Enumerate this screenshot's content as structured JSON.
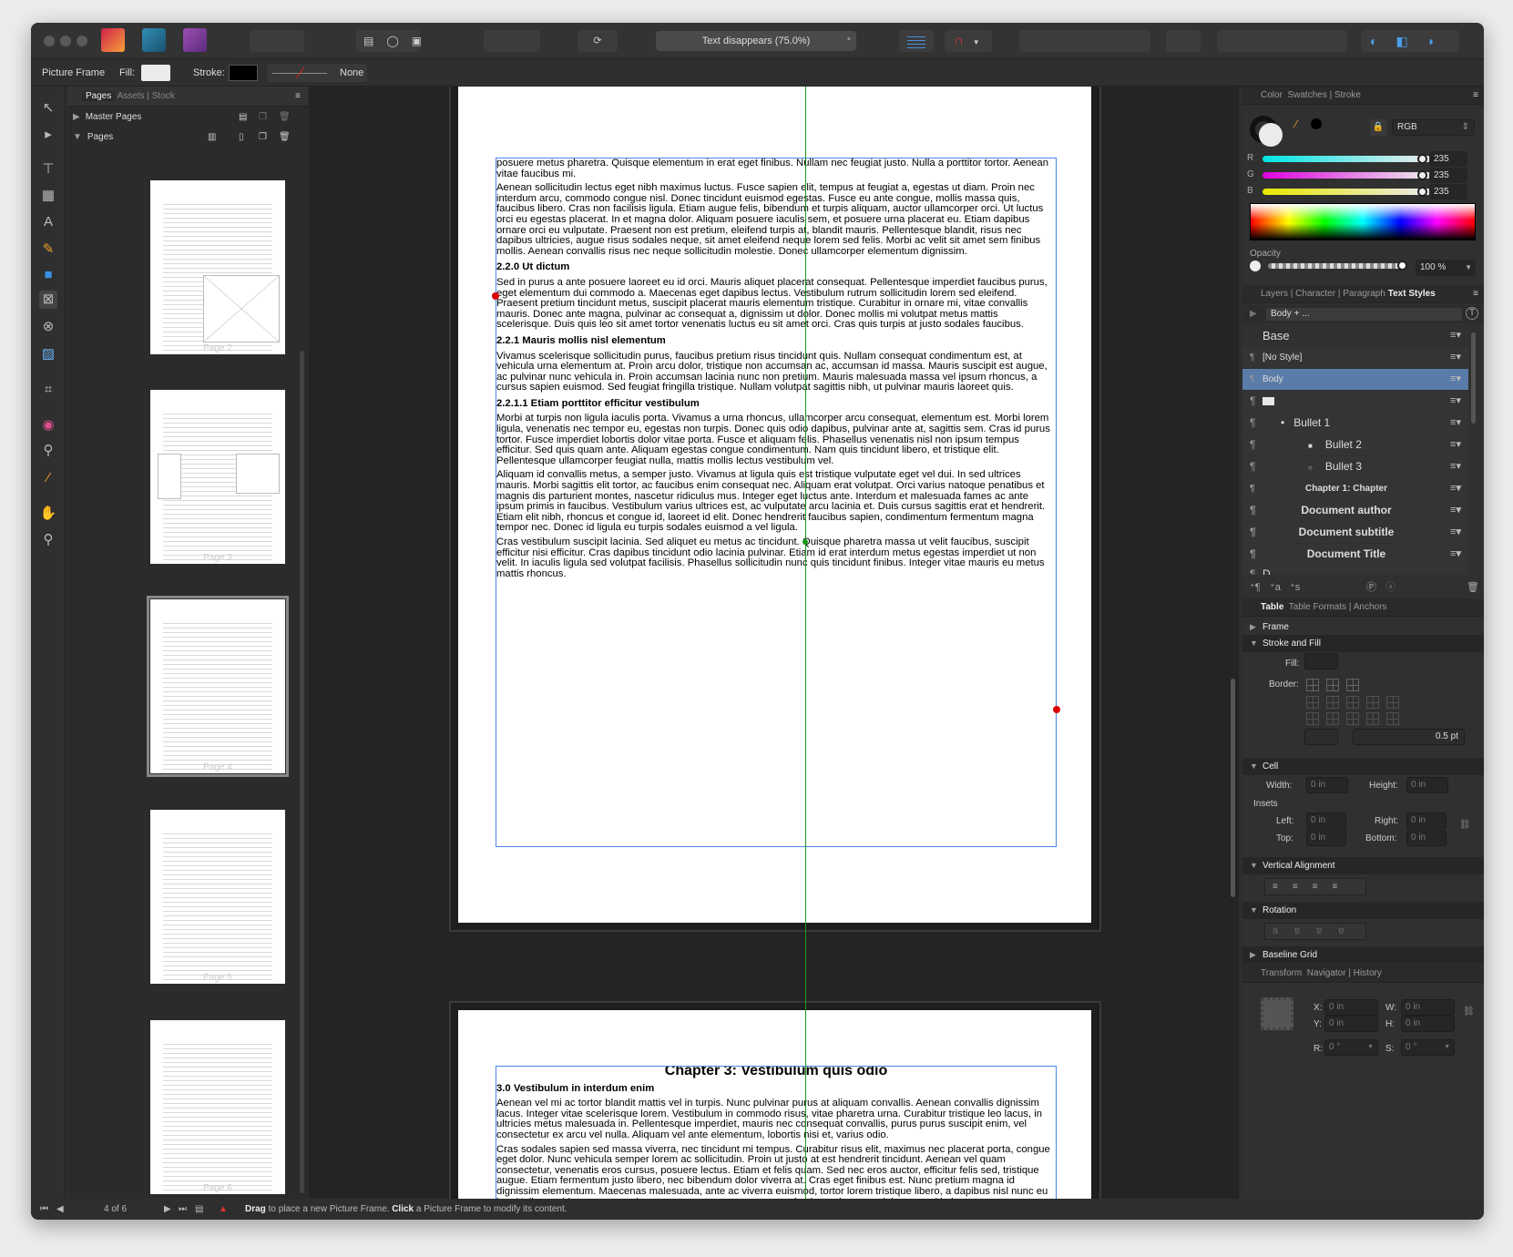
{
  "toolbar": {
    "title_field": "Text disappears (75.0%)",
    "title_star": "*"
  },
  "context": {
    "tool": "Picture Frame",
    "fill_label": "Fill:",
    "stroke_label": "Stroke:",
    "stroke_value": "None",
    "fill_color": "#ebebeb",
    "stroke_color": "#000000"
  },
  "pages_panel": {
    "tabs": [
      "Pages",
      "Assets",
      "Stock"
    ],
    "master_pages": "Master Pages",
    "pages": "Pages",
    "thumbnails": [
      {
        "label": "Page 2"
      },
      {
        "label": "Page 3"
      },
      {
        "label": "Page 4"
      },
      {
        "label": "Page 5"
      },
      {
        "label": "Page 6"
      }
    ],
    "selected": "Page 4"
  },
  "document": {
    "page1": [
      {
        "type": "p",
        "text": "posuere metus pharetra. Quisque elementum in erat eget finibus. Nullam nec feugiat justo. Nulla a porttitor tortor. Aenean vitae faucibus mi."
      },
      {
        "type": "p",
        "text": "Aenean sollicitudin lectus eget nibh maximus luctus. Fusce sapien elit, tempus at feugiat a, egestas ut diam. Proin nec interdum arcu, commodo congue nisl. Donec tincidunt euismod egestas. Fusce eu ante congue, mollis massa quis, faucibus libero. Cras non facilisis ligula. Etiam augue felis, bibendum et turpis aliquam, auctor ullamcorper orci. Ut luctus orci eu egestas placerat. In et magna dolor. Aliquam posuere iaculis sem, et posuere urna placerat eu. Etiam dapibus ornare orci eu vulputate. Praesent non est pretium, eleifend turpis at, blandit mauris. Pellentesque blandit, risus nec dapibus ultricies, augue risus sodales neque, sit amet eleifend neque lorem sed felis. Morbi ac velit sit amet sem finibus mollis. Aenean convallis risus nec neque sollicitudin molestie. Donec ullamcorper elementum dignissim."
      },
      {
        "type": "h",
        "text": "2.2.0 Ut dictum"
      },
      {
        "type": "p",
        "text": "Sed in purus a ante posuere laoreet eu id orci. Mauris aliquet placerat consequat. Pellentesque imperdiet faucibus purus, eget elementum dui commodo a. Maecenas eget dapibus lectus. Vestibulum rutrum sollicitudin lorem sed eleifend. Praesent pretium tincidunt metus, suscipit placerat mauris elementum tristique. Curabitur in ornare mi, vitae convallis mauris. Donec ante magna, pulvinar ac consequat a, dignissim ut dolor. Donec mollis mi volutpat metus mattis scelerisque. Duis quis leo sit amet tortor venenatis luctus eu sit amet orci. Cras quis turpis at justo sodales faucibus."
      },
      {
        "type": "h",
        "text": "2.2.1 Mauris mollis nisl elementum"
      },
      {
        "type": "p",
        "text": "Vivamus scelerisque sollicitudin purus, faucibus pretium risus tincidunt quis. Nullam consequat condimentum est, at vehicula urna elementum at. Proin arcu dolor, tristique non accumsan ac, accumsan id massa. Mauris suscipit est augue, ac pulvinar nunc vehicula in. Proin accumsan lacinia nunc non pretium. Mauris malesuada massa vel ipsum rhoncus, a cursus sapien euismod. Sed feugiat fringilla tristique. Nullam volutpat sagittis nibh, ut pulvinar mauris laoreet quis."
      },
      {
        "type": "h",
        "text": "2.2.1.1 Etiam porttitor efficitur vestibulum"
      },
      {
        "type": "p",
        "text": "Morbi at turpis non ligula iaculis porta. Vivamus a urna rhoncus, ullamcorper arcu consequat, elementum est. Morbi lorem ligula, venenatis nec tempor eu, egestas non turpis. Donec quis odio dapibus, pulvinar ante at, sagittis sem. Cras id purus tortor. Fusce imperdiet lobortis dolor vitae porta. Fusce et aliquam felis. Phasellus venenatis nisl non ipsum tempus efficitur. Sed quis quam ante. Aliquam egestas congue condimentum. Nam quis tincidunt libero, et tristique elit. Pellentesque ullamcorper feugiat nulla, mattis mollis lectus vestibulum vel."
      },
      {
        "type": "p",
        "text": "Aliquam id convallis metus, a semper justo. Vivamus at ligula quis est tristique vulputate eget vel dui. In sed ultrices mauris. Morbi sagittis elit tortor, ac faucibus enim consequat nec. Aliquam erat volutpat. Orci varius natoque penatibus et magnis dis parturient montes, nascetur ridiculus mus. Integer eget luctus ante. Interdum et malesuada fames ac ante ipsum primis in faucibus. Vestibulum varius ultrices est, ac vulputate arcu lacinia et. Duis cursus sagittis erat et hendrerit. Etiam elit nibh, rhoncus et congue id, laoreet id elit. Donec hendrerit faucibus sapien, condimentum fermentum magna tempor nec. Donec id ligula eu turpis sodales euismod a vel ligula."
      },
      {
        "type": "p",
        "text": "Cras vestibulum suscipit lacinia. Sed aliquet eu metus ac tincidunt. Quisque pharetra massa ut velit faucibus, suscipit efficitur nisi efficitur. Cras dapibus tincidunt odio lacinia pulvinar. Etiam id erat interdum metus egestas imperdiet ut non velit. In iaculis ligula sed volutpat facilisis. Phasellus sollicitudin nunc quis tincidunt finibus. Integer vitae mauris eu metus mattis rhoncus."
      }
    ],
    "page2": {
      "chapter_title": "Chapter 3: Vestibulum quis odio",
      "heading": "3.0 Vestibulum in interdum enim",
      "paragraphs": [
        "Aenean vel mi ac tortor blandit mattis vel in turpis. Nunc pulvinar purus at aliquam convallis. Aenean convallis dignissim lacus. Integer vitae scelerisque lorem. Vestibulum in commodo risus, vitae pharetra urna. Curabitur tristique leo lacus, in ultricies metus malesuada in. Pellentesque imperdiet, mauris nec consequat convallis, purus purus suscipit enim, vel consectetur ex arcu vel nulla. Aliquam vel ante elementum, lobortis nisi et, varius odio.",
        "Cras sodales sapien sed massa viverra, nec tincidunt mi tempus. Curabitur risus elit, maximus nec placerat porta, congue eget dolor. Nunc vehicula semper lorem ac sollicitudin. Proin ut justo at est hendrerit tincidunt. Aenean vel quam consectetur, venenatis eros cursus, posuere lectus. Etiam et felis quam. Sed nec eros auctor, efficitur felis sed, tristique augue. Etiam fermentum justo libero, nec bibendum dolor viverra at. Cras eget finibus est. Nunc pretium magna id dignissim elementum. Maecenas malesuada, ante ac viverra euismod, tortor lorem tristique libero, a dapibus nisl nunc eu leo. Nulla gravida, urna ut maximus consequat, massa massa molestie turpis, eu sagittis nunc mi in justo."
      ]
    }
  },
  "color_panel": {
    "tabs": [
      "Color",
      "Swatches",
      "Stroke"
    ],
    "model": "RGB",
    "r_label": "R",
    "g_label": "G",
    "b_label": "B",
    "r": "235",
    "g": "235",
    "b": "235",
    "opacity_label": "Opacity",
    "opacity": "100 %"
  },
  "styles_panel": {
    "tabs": [
      "Layers",
      "Character",
      "Paragraph",
      "Text Styles"
    ],
    "active_tab": "Text Styles",
    "current": "Body + ...",
    "group": "Base",
    "styles": [
      "[No Style]",
      "Body",
      "",
      "Bullet 1",
      "Bullet 2",
      "Bullet 3",
      "Chapter 1: Chapter",
      "Document author",
      "Document subtitle",
      "Document Title",
      "D..."
    ],
    "selected": "Body",
    "selected_color": "#5a7ca8"
  },
  "table_panel": {
    "tabs": [
      "Table",
      "Table Formats",
      "Anchors"
    ],
    "frame": "Frame",
    "stroke_fill": "Stroke and Fill",
    "fill_label": "Fill:",
    "border_label": "Border:",
    "stroke_width": "0.5 pt",
    "cell": "Cell",
    "width_label": "Width:",
    "height_label": "Height:",
    "insets": "Insets",
    "left_label": "Left:",
    "right_label": "Right:",
    "top_label": "Top:",
    "bottom_label": "Bottom:",
    "zero_in": "0 in",
    "vertical_alignment": "Vertical Alignment",
    "rotation": "Rotation",
    "baseline_grid": "Baseline Grid"
  },
  "transform_panel": {
    "tabs": [
      "Transform",
      "Navigator",
      "History"
    ],
    "x_label": "X:",
    "y_label": "Y:",
    "w_label": "W:",
    "h_label": "H:",
    "r_label": "R:",
    "s_label": "S:",
    "x": "0 in",
    "y": "0 in",
    "w": "0 in",
    "h": "0 in",
    "r": "0 °",
    "s": "0 °"
  },
  "status": {
    "page_indicator": "4 of 6",
    "hint_drag": "Drag",
    "hint_mid": " to place a new Picture Frame. ",
    "hint_click": "Click",
    "hint_end": " a Picture Frame to modify its content."
  }
}
